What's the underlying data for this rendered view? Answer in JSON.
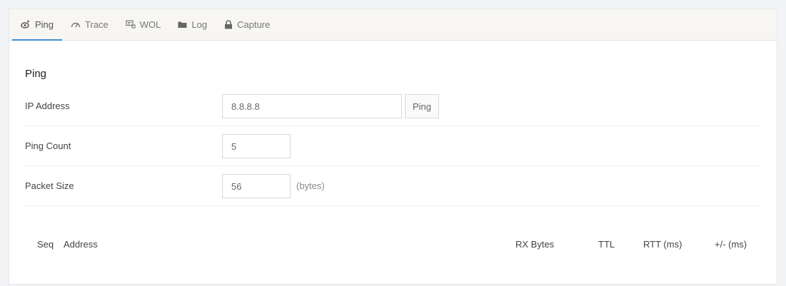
{
  "tabs": [
    {
      "label": "Ping",
      "icon": "ping-icon",
      "active": true
    },
    {
      "label": "Trace",
      "icon": "gauge-icon",
      "active": false
    },
    {
      "label": "WOL",
      "icon": "network-icon",
      "active": false
    },
    {
      "label": "Log",
      "icon": "folder-icon",
      "active": false
    },
    {
      "label": "Capture",
      "icon": "lock-icon",
      "active": false
    }
  ],
  "colors": {
    "accent": "#3d8fd1",
    "tab_bg": "#f7f6f2"
  },
  "ping": {
    "title": "Ping",
    "ip_address": {
      "label": "IP Address",
      "value": "8.8.8.8",
      "button_label": "Ping"
    },
    "ping_count": {
      "label": "Ping Count",
      "value": "5"
    },
    "packet_size": {
      "label": "Packet Size",
      "value": "56",
      "suffix": "(bytes)"
    },
    "results_columns": [
      "Seq",
      "Address",
      "RX Bytes",
      "TTL",
      "RTT (ms)",
      "+/- (ms)"
    ]
  }
}
